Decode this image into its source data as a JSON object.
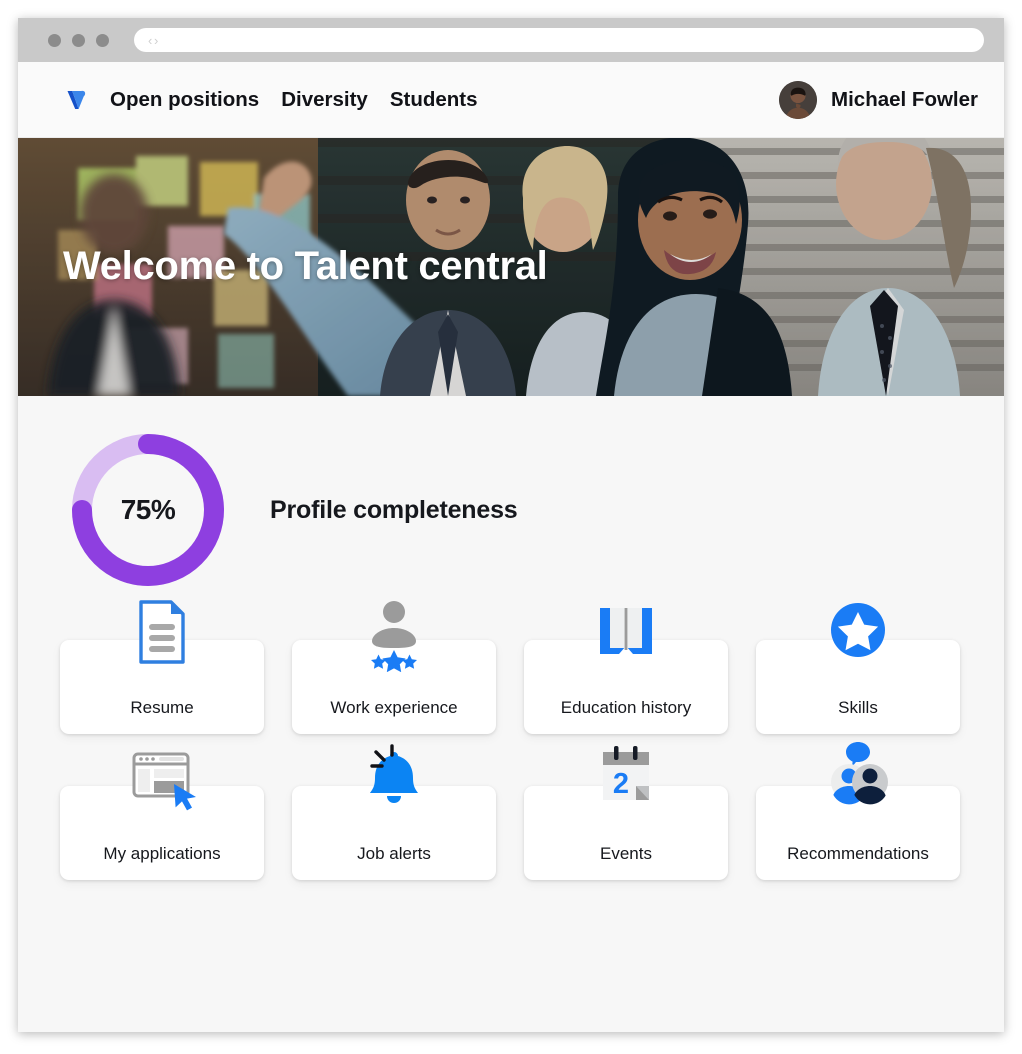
{
  "browser": {
    "nav_arrows": "‹ ›",
    "url_value": "",
    "url_placeholder": ""
  },
  "header": {
    "logo_icon": "vodafone-v-logo-icon",
    "nav_items": [
      {
        "label": "Open positions",
        "name": "nav-open-positions"
      },
      {
        "label": "Diversity",
        "name": "nav-diversity"
      },
      {
        "label": "Students",
        "name": "nav-students"
      }
    ],
    "user": {
      "name": "Michael Fowler",
      "avatar_icon": "user-avatar"
    }
  },
  "hero": {
    "title": "Welcome to Talent central",
    "image_alt": "team at sticky-note wall"
  },
  "profile": {
    "percent_label": "75%",
    "percent_value": 75,
    "title": "Profile completeness",
    "arc_color": "#8e3fe0",
    "track_color": "#d9bdf2"
  },
  "cards": [
    {
      "label": "Resume",
      "name": "card-resume",
      "icon": "document-icon"
    },
    {
      "label": "Work experience",
      "name": "card-work-experience",
      "icon": "person-stars-icon"
    },
    {
      "label": "Education history",
      "name": "card-education-history",
      "icon": "open-book-icon"
    },
    {
      "label": "Skills",
      "name": "card-skills",
      "icon": "star-badge-icon"
    },
    {
      "label": "My applications",
      "name": "card-my-applications",
      "icon": "browser-cursor-icon"
    },
    {
      "label": "Job alerts",
      "name": "card-job-alerts",
      "icon": "bell-icon"
    },
    {
      "label": "Events",
      "name": "card-events",
      "icon": "calendar-icon",
      "badge": "2"
    },
    {
      "label": "Recommendations",
      "name": "card-recommendations",
      "icon": "people-chat-icon"
    }
  ],
  "colors": {
    "accent_blue": "#1a7cf5",
    "dark_navy": "#0d1f3c",
    "gray_icon": "#9a9a9a",
    "purple": "#8e3fe0",
    "page_bg": "#f7f7f7"
  }
}
